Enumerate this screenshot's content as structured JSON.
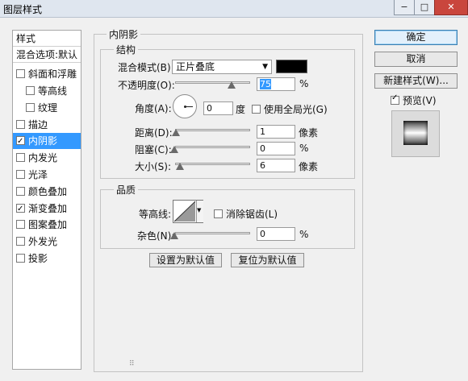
{
  "window": {
    "title": "图层样式",
    "minimize": "−",
    "maximize": "□",
    "close": "✕"
  },
  "left_panel": {
    "header1": "样式",
    "header2": "混合选项:默认",
    "items": [
      {
        "label": "斜面和浮雕",
        "checked": false
      },
      {
        "label": "等高线",
        "checked": false
      },
      {
        "label": "纹理",
        "checked": false
      },
      {
        "label": "描边",
        "checked": false
      },
      {
        "label": "内阴影",
        "checked": true
      },
      {
        "label": "内发光",
        "checked": false
      },
      {
        "label": "光泽",
        "checked": false
      },
      {
        "label": "颜色叠加",
        "checked": false
      },
      {
        "label": "渐变叠加",
        "checked": true
      },
      {
        "label": "图案叠加",
        "checked": false
      },
      {
        "label": "外发光",
        "checked": false
      },
      {
        "label": "投影",
        "checked": false
      }
    ]
  },
  "inner_shadow": {
    "title": "内阴影",
    "structure": {
      "title": "结构",
      "blend_mode_label": "混合模式(B):",
      "blend_mode_value": "正片叠底",
      "blend_color": "#000000",
      "opacity_label": "不透明度(O):",
      "opacity_value": "75",
      "opacity_unit": "%",
      "angle_label": "角度(A):",
      "angle_value": "0",
      "angle_unit": "度",
      "global_light_label": "使用全局光(G)",
      "global_light_checked": false,
      "distance_label": "距离(D):",
      "distance_value": "1",
      "distance_unit": "像素",
      "choke_label": "阻塞(C):",
      "choke_value": "0",
      "choke_unit": "%",
      "size_label": "大小(S):",
      "size_value": "6",
      "size_unit": "像素"
    },
    "quality": {
      "title": "品质",
      "contour_label": "等高线:",
      "anti_alias_label": "消除锯齿(L)",
      "anti_alias_checked": false,
      "noise_label": "杂色(N):",
      "noise_value": "0",
      "noise_unit": "%"
    },
    "make_default": "设置为默认值",
    "reset_default": "复位为默认值"
  },
  "right_panel": {
    "ok": "确定",
    "cancel": "取消",
    "new_style": "新建样式(W)...",
    "preview_label": "预览(V)",
    "preview_checked": true
  }
}
